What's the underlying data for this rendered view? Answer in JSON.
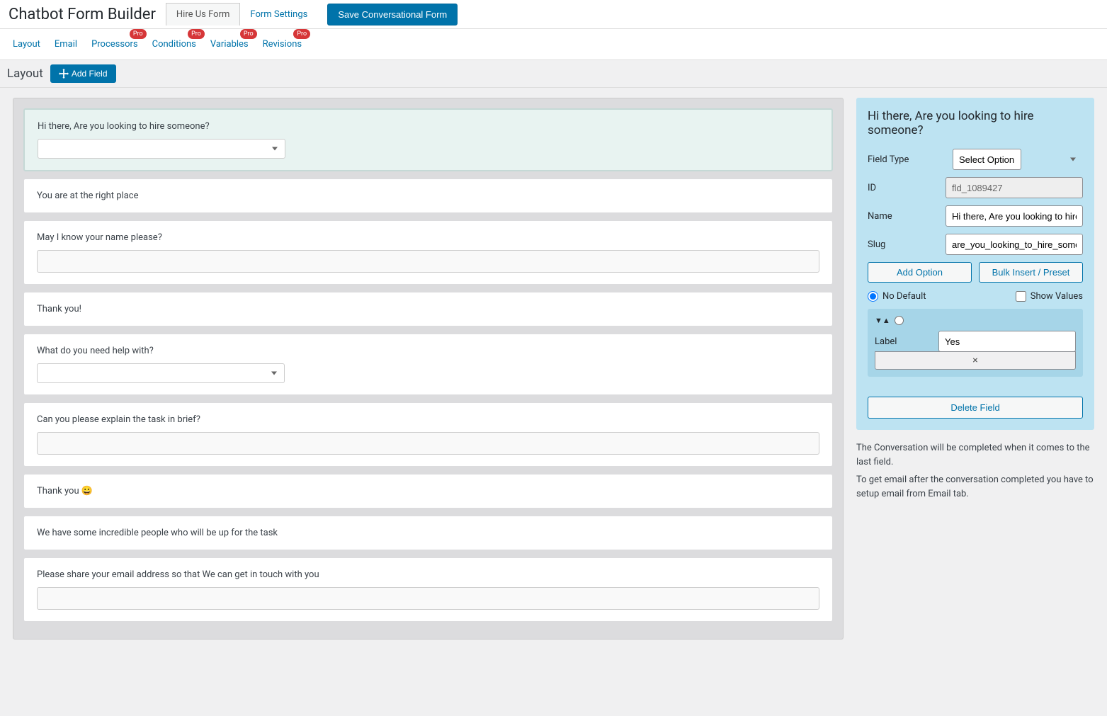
{
  "header": {
    "app_title": "Chatbot Form Builder",
    "tabs": {
      "hire_us": "Hire Us Form",
      "form_settings": "Form Settings"
    },
    "save_label": "Save Conversational Form"
  },
  "sub_tabs": {
    "layout": "Layout",
    "email": "Email",
    "processors": "Processors",
    "conditions": "Conditions",
    "variables": "Variables",
    "revisions": "Revisions",
    "pro": "Pro"
  },
  "layout_bar": {
    "title": "Layout",
    "add_field": "Add Field"
  },
  "fields": [
    {
      "label": "Hi there, Are you looking to hire someone?",
      "type": "select",
      "selected": true
    },
    {
      "label": "You are at the right place",
      "type": "static"
    },
    {
      "label": "May I know your name please?",
      "type": "text"
    },
    {
      "label": "Thank you!",
      "type": "static"
    },
    {
      "label": "What do you need help with?",
      "type": "select"
    },
    {
      "label": "Can you please explain the task in brief?",
      "type": "text"
    },
    {
      "label": "Thank you 😀",
      "type": "static"
    },
    {
      "label": "We have some incredible people who will be up for the task",
      "type": "static"
    },
    {
      "label": "Please share your email address so that We can get in touch with you",
      "type": "text"
    }
  ],
  "panel": {
    "title": "Hi there, Are you looking to hire someone?",
    "field_type_label": "Field Type",
    "field_type_value": "Select Option",
    "id_label": "ID",
    "id_value": "fld_1089427",
    "name_label": "Name",
    "name_value": "Hi there, Are you looking to hire someone?",
    "slug_label": "Slug",
    "slug_value": "are_you_looking_to_hire_someone",
    "add_option": "Add Option",
    "bulk_insert": "Bulk Insert / Preset",
    "no_default": "No Default",
    "show_values": "Show Values",
    "option_label_label": "Label",
    "option_label_value": "Yes",
    "remove_icon": "×",
    "delete_field": "Delete Field"
  },
  "info": {
    "line1": "The Conversation will be completed when it comes to the last field.",
    "line2": "To get email after the conversation completed you have to setup email from Email tab."
  }
}
